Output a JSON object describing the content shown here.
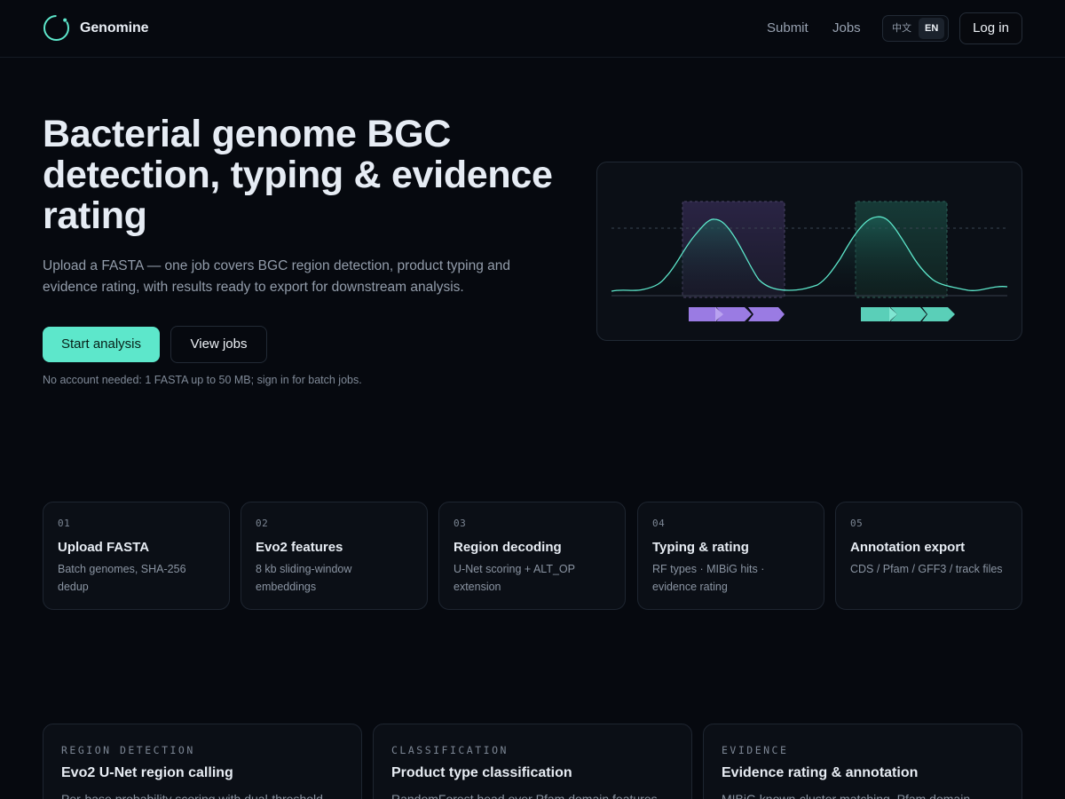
{
  "header": {
    "brand": "Genomine",
    "nav": {
      "submit": "Submit",
      "jobs": "Jobs"
    },
    "lang": {
      "zh": "中文",
      "en": "EN",
      "active": "EN"
    },
    "login": "Log in"
  },
  "hero": {
    "title": "Bacterial genome BGC detection, typing & evidence rating",
    "subtitle": "Upload a FASTA — one job covers BGC region detection, product typing and evidence rating, with results ready to export for downstream analysis.",
    "primary_cta": "Start analysis",
    "secondary_cta": "View jobs",
    "note": "No account needed: 1 FASTA up to 50 MB; sign in for batch jobs."
  },
  "viz": {
    "colors": {
      "line": "#5de7cb",
      "region_a": "#9a7be3",
      "region_b": "#5acfb8"
    }
  },
  "steps": [
    {
      "num": "01",
      "title": "Upload FASTA",
      "desc": "Batch genomes, SHA-256 dedup"
    },
    {
      "num": "02",
      "title": "Evo2 features",
      "desc": "8 kb sliding-window embeddings"
    },
    {
      "num": "03",
      "title": "Region decoding",
      "desc": "U-Net scoring + ALT_OP extension"
    },
    {
      "num": "04",
      "title": "Typing & rating",
      "desc": "RF types · MIBiG hits · evidence rating"
    },
    {
      "num": "05",
      "title": "Annotation export",
      "desc": "CDS / Pfam / GFF3 / track files"
    }
  ],
  "features": [
    {
      "tag": "REGION DETECTION",
      "title": "Evo2 U-Net region calling",
      "desc": "Per-base probability scoring with dual-threshold"
    },
    {
      "tag": "CLASSIFICATION",
      "title": "Product type classification",
      "desc": "RandomForest head over Pfam domain features"
    },
    {
      "tag": "EVIDENCE",
      "title": "Evidence rating & annotation",
      "desc": "MIBiG known-cluster matching, Pfam domain"
    }
  ],
  "colors": {
    "accent": "#5de7cb",
    "background": "#06090f",
    "card": "#0b0f16"
  }
}
